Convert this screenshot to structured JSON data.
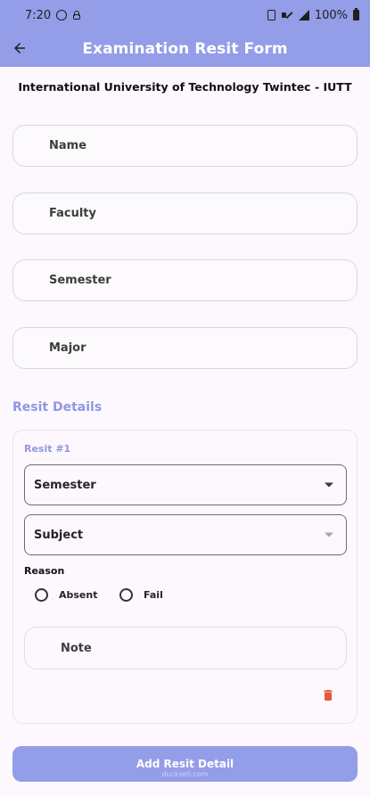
{
  "status_bar": {
    "time": "7:20",
    "battery": "100%"
  },
  "app_bar": {
    "title": "Examination Resit Form"
  },
  "org": {
    "title": "International University of Technology Twintec - IUTT"
  },
  "form": {
    "name_placeholder": "Name",
    "faculty_placeholder": "Faculty",
    "semester_placeholder": "Semester",
    "major_placeholder": "Major"
  },
  "resit_section": {
    "title": "Resit Details",
    "items": [
      {
        "label": "Resit #1",
        "semester_placeholder": "Semester",
        "subject_placeholder": "Subject",
        "reason_label": "Reason",
        "reason_options": [
          "Absent",
          "Fail"
        ],
        "note_placeholder": "Note"
      }
    ]
  },
  "actions": {
    "add_resit_label": "Add Resit Detail"
  },
  "watermark": {
    "text": "ducksell.com"
  },
  "icons": {
    "back": "back-arrow-icon",
    "delete": "delete-icon",
    "dropdown": "dropdown-icon"
  },
  "colors": {
    "accent": "#939de8",
    "section_label": "#8e97e2",
    "danger": "#e9543c"
  }
}
